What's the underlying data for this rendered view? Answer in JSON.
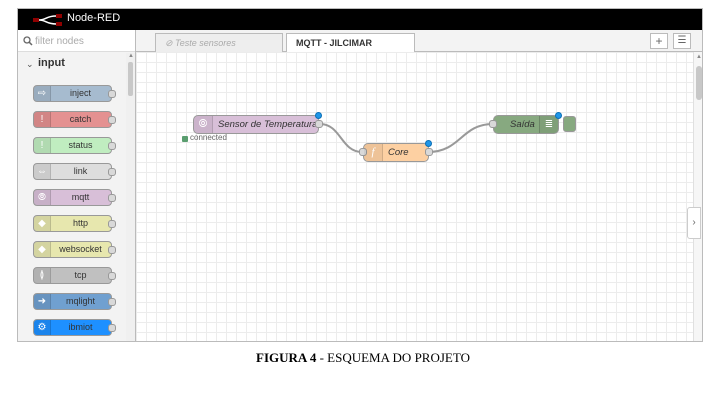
{
  "header": {
    "title": "Node-RED"
  },
  "palette": {
    "filter_placeholder": "filter nodes",
    "category": "input",
    "nodes": [
      {
        "label": "inject",
        "color": "#a6bbcf",
        "icon": "arrow-right-icon"
      },
      {
        "label": "catch",
        "color": "#e49191",
        "icon": "exclamation-icon"
      },
      {
        "label": "status",
        "color": "#c0edc0",
        "icon": "exclamation-icon"
      },
      {
        "label": "link",
        "color": "#dddddd",
        "icon": "link-icon"
      },
      {
        "label": "mqtt",
        "color": "#d8bfd8",
        "icon": "wireless-icon"
      },
      {
        "label": "http",
        "color": "#e7e7ae",
        "icon": "globe-icon"
      },
      {
        "label": "websocket",
        "color": "#e7e7ae",
        "icon": "globe-icon"
      },
      {
        "label": "tcp",
        "color": "#c0c0c0",
        "icon": "bridge-icon"
      },
      {
        "label": "mqlight",
        "color": "#70a0d0",
        "icon": "mqlight-icon"
      },
      {
        "label": "ibmiot",
        "color": "#1e90ff",
        "icon": "gear-icon"
      }
    ]
  },
  "tabs": [
    {
      "label": "⊘ Teste sensores",
      "active": false
    },
    {
      "label": "MQTT - JILCIMAR",
      "active": true
    }
  ],
  "flow": {
    "nodes": [
      {
        "label": "Sensor de Temperatura",
        "color": "#d8bfd8",
        "status": "connected",
        "status_color": "#5a9e6f"
      },
      {
        "label": "Core",
        "color": "#fdd0a2",
        "icon": "f"
      },
      {
        "label": "Saída",
        "color": "#87a980"
      }
    ]
  },
  "caption": {
    "bold": "FIGURA 4",
    "rest": " - ESQUEMA DO PROJETO"
  }
}
